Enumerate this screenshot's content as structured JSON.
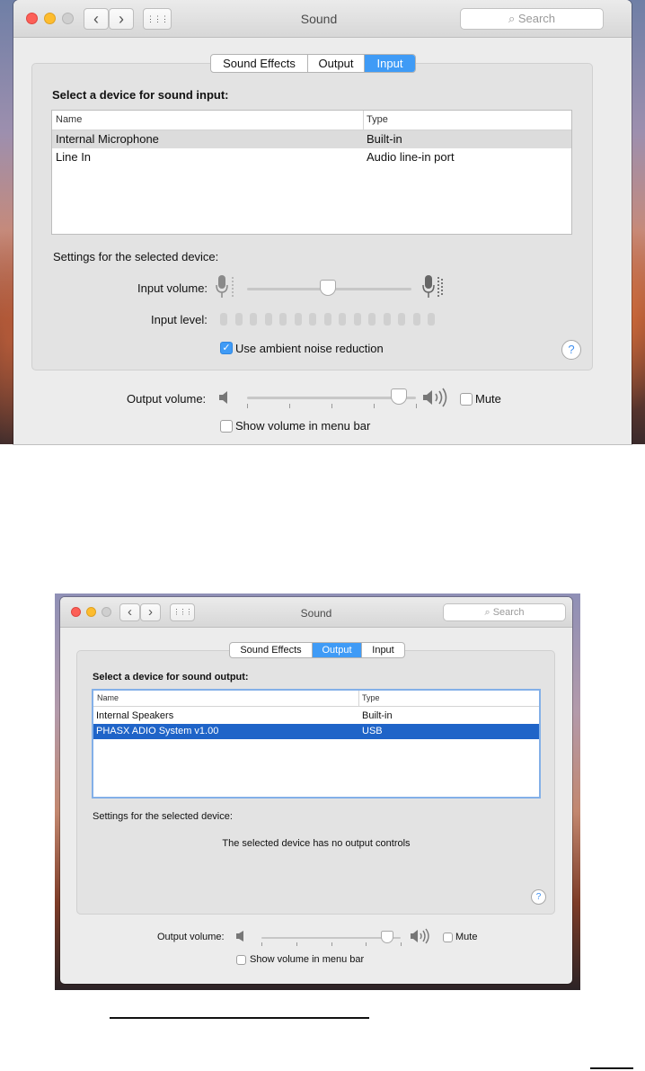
{
  "window1": {
    "title": "Sound",
    "search_placeholder": "Search",
    "tabs": [
      {
        "label": "Sound Effects",
        "active": false
      },
      {
        "label": "Output",
        "active": false
      },
      {
        "label": "Input",
        "active": true
      }
    ],
    "heading": "Select a device for sound input:",
    "table": {
      "columns": [
        "Name",
        "Type"
      ],
      "rows": [
        {
          "name": "Internal Microphone",
          "type": "Built-in",
          "selected": true
        },
        {
          "name": "Line In",
          "type": "Audio line-in port",
          "selected": false
        }
      ]
    },
    "settings_label": "Settings for the selected device:",
    "input_volume_label": "Input volume:",
    "input_volume_value": 0.49,
    "input_level_label": "Input level:",
    "ambient_noise_label": "Use ambient noise reduction",
    "ambient_noise_checked": true,
    "output_volume_label": "Output volume:",
    "output_volume_value": 0.9,
    "mute_label": "Mute",
    "menu_bar_label": "Show volume in menu bar",
    "help": "?"
  },
  "window2": {
    "title": "Sound",
    "search_placeholder": "Search",
    "tabs": [
      {
        "label": "Sound Effects",
        "active": false
      },
      {
        "label": "Output",
        "active": true
      },
      {
        "label": "Input",
        "active": false
      }
    ],
    "heading": "Select a device for sound output:",
    "table": {
      "columns": [
        "Name",
        "Type"
      ],
      "rows": [
        {
          "name": "Internal Speakers",
          "type": "Built-in",
          "selected": false
        },
        {
          "name": "PHASX ADIO System v1.00",
          "type": "USB",
          "selected": true
        }
      ]
    },
    "settings_label": "Settings for the selected device:",
    "no_controls": "The selected device has no output controls",
    "output_volume_label": "Output volume:",
    "output_volume_value": 0.9,
    "mute_label": "Mute",
    "menu_bar_label": "Show volume in menu bar",
    "help": "?"
  },
  "colors": {
    "accent": "#3f9bf6",
    "selection": "#1f64c8",
    "close": "#fc5f57",
    "minimize": "#fdbc2e"
  },
  "icons": {
    "back": "‹",
    "forward": "›",
    "grid": "⋮⋮⋮",
    "search": "⌕",
    "mic": "🎙",
    "speaker_low": "◀",
    "speaker_high": "◀)))"
  }
}
